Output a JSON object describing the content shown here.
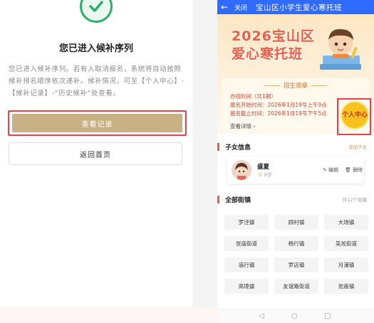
{
  "left": {
    "title": "您已进入候补序列",
    "description": "您已进入候补序列。若有人取消报名，系统将自动按照候补排名顺序依次递补。候补情况，可至【个人中心】-【候补记录】-“历史候补”处查看。",
    "view_records_label": "查看记录",
    "back_home_label": "返回首页"
  },
  "right": {
    "topbar": {
      "back_icon": "←",
      "close_label": "关闭",
      "title": "宝山区小学生爱心寒托班"
    },
    "banner": {
      "title_line1": "2026宝山区",
      "title_line2": "爱心寒托班",
      "section_head": "招生简章",
      "line1": "办班时间（共1期）",
      "line2": "报名开始时间：2026年1月19号上午9点",
      "line3": "报名截止时间：2026年1月19号下午5点",
      "more": "查看详情 ›",
      "center_button": "个人中心"
    },
    "children": {
      "header": "子女信息",
      "add_link": "添加子女",
      "child_name": "盛夏",
      "child_age": "9岁",
      "edit_label": "编辑",
      "delete_label": "删除"
    },
    "towns": {
      "header": "全部街镇",
      "count_text": "共12个街镇",
      "items": [
        "罗泾镇",
        "顾村镇",
        "大场镇",
        "张庙街道",
        "杨行镇",
        "吴淞街道",
        "庙行镇",
        "罗店镇",
        "月浦镇",
        "高境镇",
        "友谊路街道",
        "淞南镇"
      ]
    },
    "nav": {
      "back_icon": "◁",
      "home_icon": "○",
      "recent_icon": "□"
    }
  }
}
